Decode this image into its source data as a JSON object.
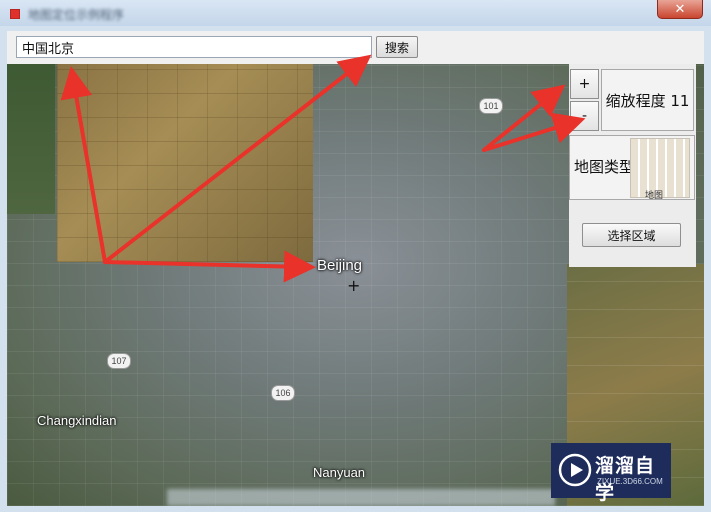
{
  "window": {
    "title": "地图定位示例程序",
    "close_label": "✕"
  },
  "toolbar": {
    "search_value": "中国北京",
    "search_label": "搜索"
  },
  "map": {
    "labels": {
      "beijing": "Beijing",
      "changxindian": "Changxindian",
      "nanyuan": "Nanyuan"
    },
    "shields": {
      "r101": "101",
      "r107": "107",
      "r106": "106"
    }
  },
  "controls": {
    "zoom_in": "+",
    "zoom_out": "-",
    "zoom_text": "缩放程度 11",
    "map_type_label": "地图类型",
    "map_thumb_caption": "地图",
    "select_region": "选择区域"
  },
  "watermark": {
    "title": "溜溜自学",
    "url": "ZIXUE.3D66.COM"
  },
  "colors": {
    "accent_red": "#e8322a",
    "brand_navy": "#1d2c5b"
  }
}
